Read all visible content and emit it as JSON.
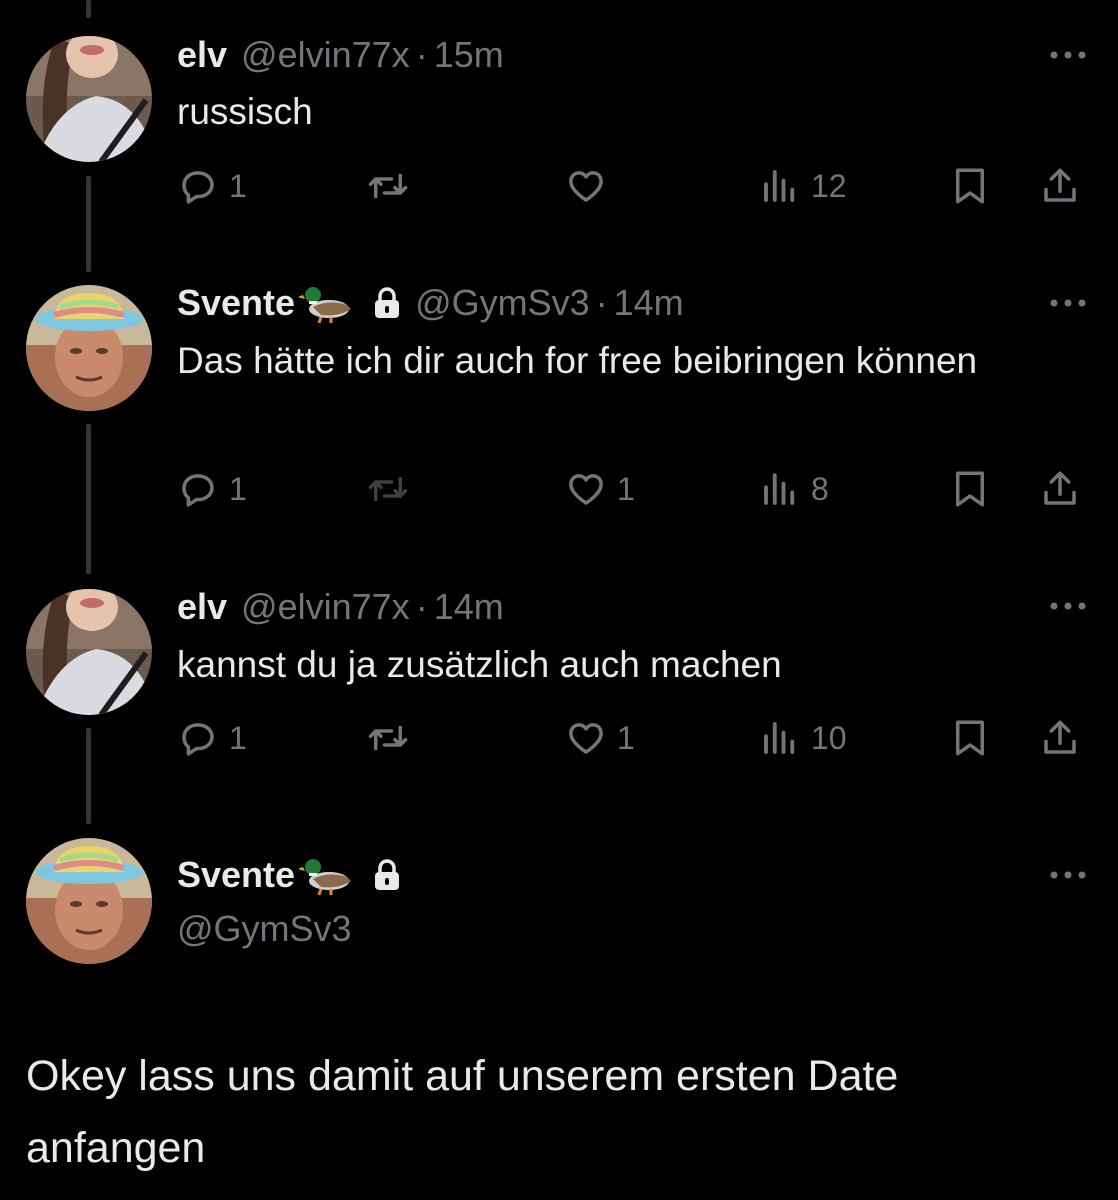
{
  "tweets": [
    {
      "name": "elv",
      "handle": "@elvin77x",
      "dot": "·",
      "time": "15m",
      "text": "russisch",
      "replies": "1",
      "retweets": "",
      "likes": "",
      "views": "12"
    },
    {
      "name": "Svente",
      "handle": "@GymSv3",
      "dot": "·",
      "time": "14m",
      "text": "Das hätte ich dir auch for free beibringen können",
      "replies": "1",
      "retweets": "",
      "likes": "1",
      "views": "8"
    },
    {
      "name": "elv",
      "handle": "@elvin77x",
      "dot": "·",
      "time": "14m",
      "text": "kannst du ja zusätzlich auch machen",
      "replies": "1",
      "retweets": "",
      "likes": "1",
      "views": "10"
    }
  ],
  "main_tweet": {
    "name": "Svente",
    "handle": "@GymSv3",
    "text": "Okey lass uns damit auf unserem ersten Date anfangen"
  },
  "icons": {
    "reply": "reply-icon",
    "retweet": "retweet-icon",
    "like": "heart-icon",
    "views": "views-icon",
    "bookmark": "bookmark-icon",
    "share": "share-icon",
    "more": "more-icon",
    "lock": "lock-icon",
    "duck": "duck-emoji"
  },
  "colors": {
    "background": "#000000",
    "text": "#e7e9ea",
    "muted": "#71767b",
    "thread_line": "#333639"
  }
}
